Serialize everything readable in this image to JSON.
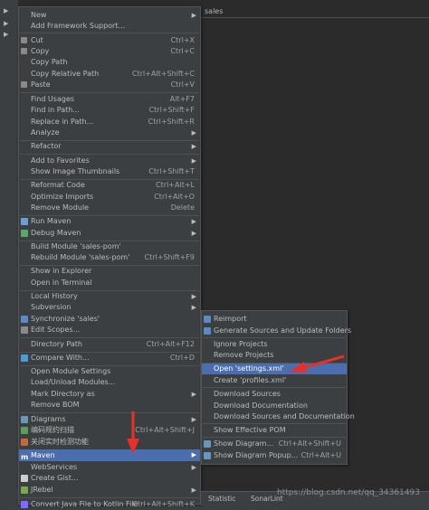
{
  "editor": {
    "tab_text": "sales"
  },
  "context_menu": {
    "items": [
      {
        "label": "New",
        "arrow": true
      },
      {
        "label": "Add Framework Support..."
      },
      {
        "label": "Cut",
        "shortcut": "Ctrl+X"
      },
      {
        "label": "Copy",
        "shortcut": "Ctrl+C"
      },
      {
        "label": "Copy Path"
      },
      {
        "label": "Copy Relative Path",
        "shortcut": "Ctrl+Alt+Shift+C"
      },
      {
        "label": "Paste",
        "shortcut": "Ctrl+V"
      },
      {
        "label": "Find Usages",
        "shortcut": "Alt+F7"
      },
      {
        "label": "Find in Path...",
        "shortcut": "Ctrl+Shift+F"
      },
      {
        "label": "Replace in Path...",
        "shortcut": "Ctrl+Shift+R"
      },
      {
        "label": "Analyze",
        "arrow": true
      },
      {
        "label": "Refactor",
        "arrow": true
      },
      {
        "label": "Add to Favorites",
        "arrow": true
      },
      {
        "label": "Show Image Thumbnails",
        "shortcut": "Ctrl+Shift+T"
      },
      {
        "label": "Reformat Code",
        "shortcut": "Ctrl+Alt+L"
      },
      {
        "label": "Optimize Imports",
        "shortcut": "Ctrl+Alt+O"
      },
      {
        "label": "Remove Module",
        "shortcut": "Delete"
      },
      {
        "label": "Run Maven",
        "arrow": true
      },
      {
        "label": "Debug Maven",
        "arrow": true
      },
      {
        "label": "Build Module 'sales-pom'"
      },
      {
        "label": "Rebuild Module 'sales-pom'",
        "shortcut": "Ctrl+Shift+F9"
      },
      {
        "label": "Show in Explorer"
      },
      {
        "label": "Open in Terminal"
      },
      {
        "label": "Local History",
        "arrow": true
      },
      {
        "label": "Subversion",
        "arrow": true
      },
      {
        "label": "Synchronize 'sales'"
      },
      {
        "label": "Edit Scopes..."
      },
      {
        "label": "Directory Path",
        "shortcut": "Ctrl+Alt+F12"
      },
      {
        "label": "Compare With...",
        "shortcut": "Ctrl+D"
      },
      {
        "label": "Open Module Settings"
      },
      {
        "label": "Load/Unload Modules..."
      },
      {
        "label": "Mark Directory as",
        "arrow": true
      },
      {
        "label": "Remove BOM"
      },
      {
        "label": "Diagrams",
        "arrow": true
      },
      {
        "label": "编码规约扫描",
        "shortcut": "Ctrl+Alt+Shift+J"
      },
      {
        "label": "关闭实时检测功能"
      },
      {
        "label": "Maven",
        "arrow": true
      },
      {
        "label": "WebServices",
        "arrow": true
      },
      {
        "label": "Create Gist..."
      },
      {
        "label": "JRebel",
        "arrow": true
      },
      {
        "label": "Convert Java File to Kotlin File",
        "shortcut": "Ctrl+Alt+Shift+K"
      }
    ]
  },
  "maven_submenu": {
    "items": [
      {
        "label": "Reimport"
      },
      {
        "label": "Generate Sources and Update Folders"
      },
      {
        "label": "Ignore Projects"
      },
      {
        "label": "Remove Projects"
      },
      {
        "label": "Open 'settings.xml'"
      },
      {
        "label": "Create 'profiles.xml'"
      },
      {
        "label": "Download Sources"
      },
      {
        "label": "Download Documentation"
      },
      {
        "label": "Download Sources and Documentation"
      },
      {
        "label": "Show Effective POM"
      },
      {
        "label": "Show Diagram...",
        "shortcut": "Ctrl+Alt+Shift+U"
      },
      {
        "label": "Show Diagram Popup...",
        "shortcut": "Ctrl+Alt+U"
      }
    ]
  },
  "status_bar": {
    "statistic": "Statistic",
    "sonarlint": "SonarLint"
  },
  "watermark": "https://blog.csdn.net/qq_34361493",
  "colors": {
    "selection": "#4b6eaf",
    "menu_bg": "#3c3f41",
    "annotation_arrow": "#e8302b"
  }
}
